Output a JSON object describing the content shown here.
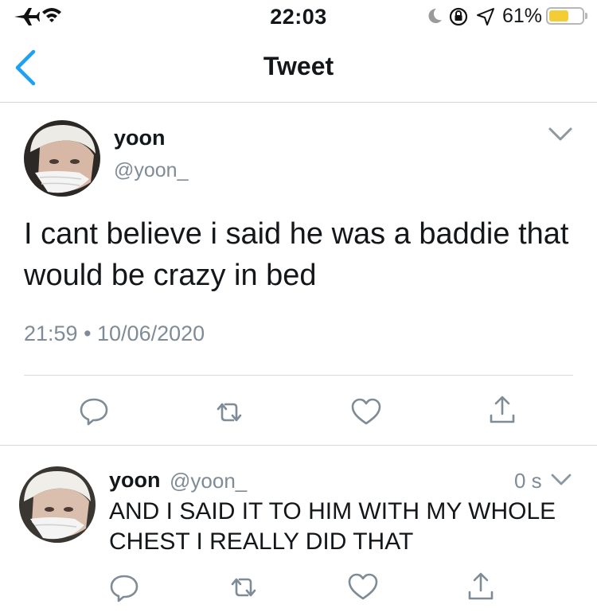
{
  "status_bar": {
    "time": "22:03",
    "battery_percent_text": "61%",
    "battery_level": 0.61,
    "left_icons": [
      "airplane-mode-icon",
      "wifi-icon"
    ],
    "right_icons": [
      "do-not-disturb-moon-icon",
      "orientation-lock-icon",
      "location-arrow-icon",
      "battery-icon"
    ],
    "battery_color": "#f4cc35"
  },
  "nav": {
    "title": "Tweet",
    "back_icon": "chevron-left-icon",
    "accent_color": "#1da1f2"
  },
  "tweet": {
    "author_name": "yoon",
    "handle": "@yoon_",
    "text": "I cant believe i said he was a baddie that would be crazy in bed",
    "timestamp": "21:59 • 10/06/2020",
    "actions": [
      "reply-icon",
      "retweet-icon",
      "like-icon",
      "share-icon"
    ]
  },
  "reply": {
    "author_name": "yoon",
    "handle": "@yoon_",
    "time_ago": "0 s",
    "text": "AND I SAID IT TO HIM WITH MY WHOLE CHEST I REALLY DID THAT",
    "actions": [
      "reply-icon",
      "retweet-icon",
      "like-icon",
      "share-icon"
    ]
  }
}
